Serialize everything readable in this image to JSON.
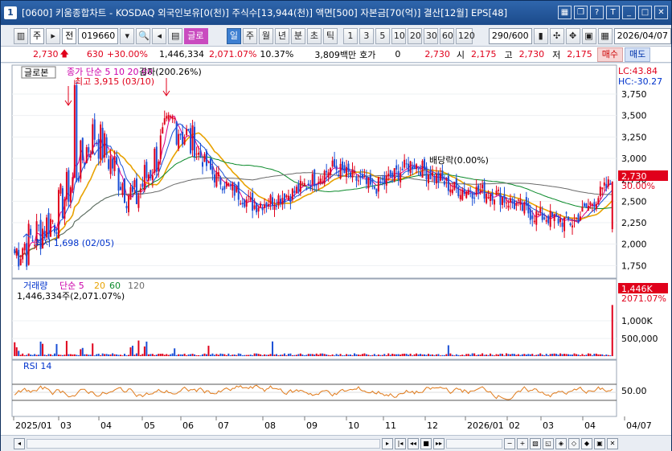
{
  "window": {
    "number": "1",
    "title": "[0600] 키움종합차트 - KOSDAQ 외국인보유[0(천)] 주식수[13,944(천)] 액면[500] 자본금[70(억)] 결산[12월] EPS[48]"
  },
  "toolbar": {
    "period_prefix": "주",
    "market": "전",
    "code": "019660",
    "stock_tag": "글로본",
    "period_tabs": [
      "일",
      "주",
      "월",
      "년",
      "분",
      "초",
      "틱"
    ],
    "selected_tab": "일",
    "intervals": [
      "1",
      "3",
      "5",
      "10",
      "20",
      "30",
      "60",
      "120"
    ],
    "count": "290/600",
    "date": "2026/04/07"
  },
  "quote": {
    "price": "2,730",
    "change": "630",
    "change_pct": "+30.00%",
    "volume": "1,446,334",
    "vol_ratio": "2,071.07%",
    "turnover": "10.37%",
    "trade_value": "3,809백만",
    "quote_label": "호가",
    "quote_val": "0",
    "ask": "2,730",
    "open_label": "시",
    "open": "2,175",
    "high_label": "고",
    "high": "2,730",
    "low_label": "저",
    "low": "2,175",
    "buy_label": "매수",
    "sell_label": "매도"
  },
  "price_panel": {
    "stock_label": "글로본",
    "legend": "종가 단순 5  10  20  60",
    "max_label": "최고 3,915 (03/10)",
    "min_label": "최저 1,698 (02/05)",
    "event_label": "감자(200.26%)",
    "div_label": "배당락(0.00%)",
    "lc": "LC:43.84",
    "hc": "HC:-30.27",
    "last_price": "2,730",
    "last_pct": "30.00%",
    "y_ticks": [
      "3,750",
      "3,500",
      "3,250",
      "3,000",
      "2,750",
      "2,500",
      "2,250",
      "2,000",
      "1,750"
    ]
  },
  "volume_panel": {
    "legend_name": "거래량",
    "legend_ma": "단순 5",
    "legend_20": "20",
    "legend_60": "60",
    "legend_120": "120",
    "value_label": "1,446,334주(2,071.07%)",
    "last_value": "1,446K",
    "last_pct": "2071.07%",
    "y_ticks": [
      "1,000K",
      "500,000"
    ]
  },
  "rsi_panel": {
    "legend": "RSI 14",
    "tick": "50.00"
  },
  "x_axis": [
    "2025/01",
    "03",
    "04",
    "05",
    "06",
    "07",
    "08",
    "09",
    "10",
    "11",
    "12",
    "2026/01",
    "02",
    "03",
    "04",
    "04/07"
  ],
  "colors": {
    "up": "#e0001b",
    "down": "#1a4fd6",
    "ma5": "#d6008a",
    "ma10": "#1a4fd6",
    "ma20": "#e8a200",
    "ma60": "#0a8a2a",
    "ma120": "#6b6b6b",
    "rsi": "#e07a1a"
  },
  "chart_data": {
    "type": "candlestick",
    "title": "",
    "x": [
      "2025/01",
      "2025/02",
      "2025/03",
      "2025/04",
      "2025/05",
      "2025/06",
      "2025/07",
      "2025/08",
      "2025/09",
      "2025/10",
      "2025/11",
      "2025/12",
      "2026/01",
      "2026/02",
      "2026/03",
      "2026/04"
    ],
    "close_monthly": [
      1900,
      2300,
      3300,
      2500,
      3450,
      2800,
      2450,
      2600,
      2900,
      2650,
      2950,
      2650,
      2600,
      2350,
      2250,
      2730
    ],
    "high": 3915,
    "low": 1698,
    "ylim": [
      1650,
      3900
    ],
    "volume_ylim": [
      0,
      1500000
    ],
    "rsi_ylim": [
      0,
      100
    ]
  }
}
